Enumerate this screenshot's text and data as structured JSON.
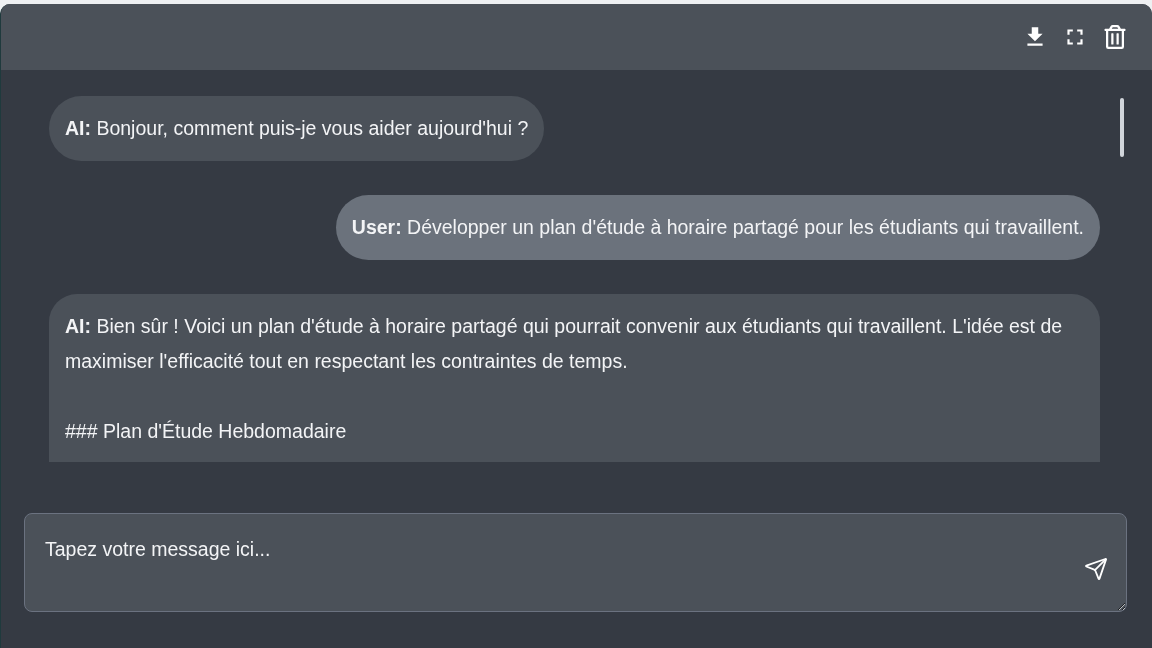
{
  "messages": [
    {
      "kind": "ai",
      "paragraphs": [
        "**AI:** Bonjour, comment puis-je vous aider aujourd'hui ?"
      ]
    },
    {
      "kind": "user",
      "paragraphs": [
        "**User:** Développer un plan d'étude à horaire partagé pour les étudiants qui travaillent."
      ]
    },
    {
      "kind": "ai",
      "paragraphs": [
        "**AI:** Bien sûr ! Voici un plan d'étude à horaire partagé qui pourrait convenir aux étudiants qui travaillent. L'idée est de maximiser l'efficacité tout en respectant les contraintes de temps.",
        "### Plan d'Étude Hebdomadaire"
      ]
    }
  ],
  "composer": {
    "placeholder": "Tapez votre message ici..."
  }
}
